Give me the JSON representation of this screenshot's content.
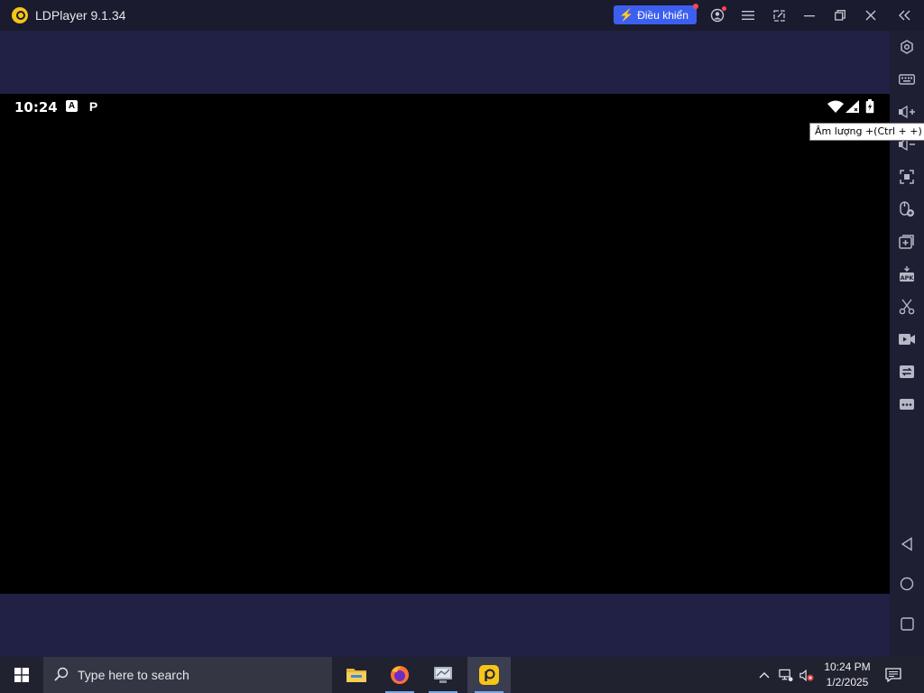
{
  "window": {
    "title": "LDPlayer 9.1.34",
    "control_button_label": "Điều khiển"
  },
  "android": {
    "status_time": "10:24",
    "status_icon_a": "A",
    "status_icon_p": "P"
  },
  "sidebar": {
    "items": [
      {
        "icon": "settings-gear-icon"
      },
      {
        "icon": "keyboard-icon"
      },
      {
        "icon": "volume-up-icon"
      },
      {
        "icon": "volume-down-icon"
      },
      {
        "icon": "fullscreen-icon"
      },
      {
        "icon": "mouse-icon"
      },
      {
        "icon": "add-instance-icon"
      },
      {
        "icon": "apk-install-icon"
      },
      {
        "icon": "scissors-icon"
      },
      {
        "icon": "video-record-icon"
      },
      {
        "icon": "sync-icon"
      },
      {
        "icon": "more-icon"
      }
    ],
    "nav": [
      {
        "icon": "back-triangle-icon"
      },
      {
        "icon": "home-circle-icon"
      },
      {
        "icon": "recents-square-icon"
      }
    ],
    "tooltip": "Âm lượng +(Ctrl + +)"
  },
  "taskbar": {
    "search_placeholder": "Type here to search",
    "clock_time": "10:24 PM",
    "clock_date": "1/2/2025"
  },
  "colors": {
    "accent": "#3d5ff0",
    "titlebar": "#1a1b2e",
    "band": "#202144",
    "taskbar": "#202230"
  }
}
